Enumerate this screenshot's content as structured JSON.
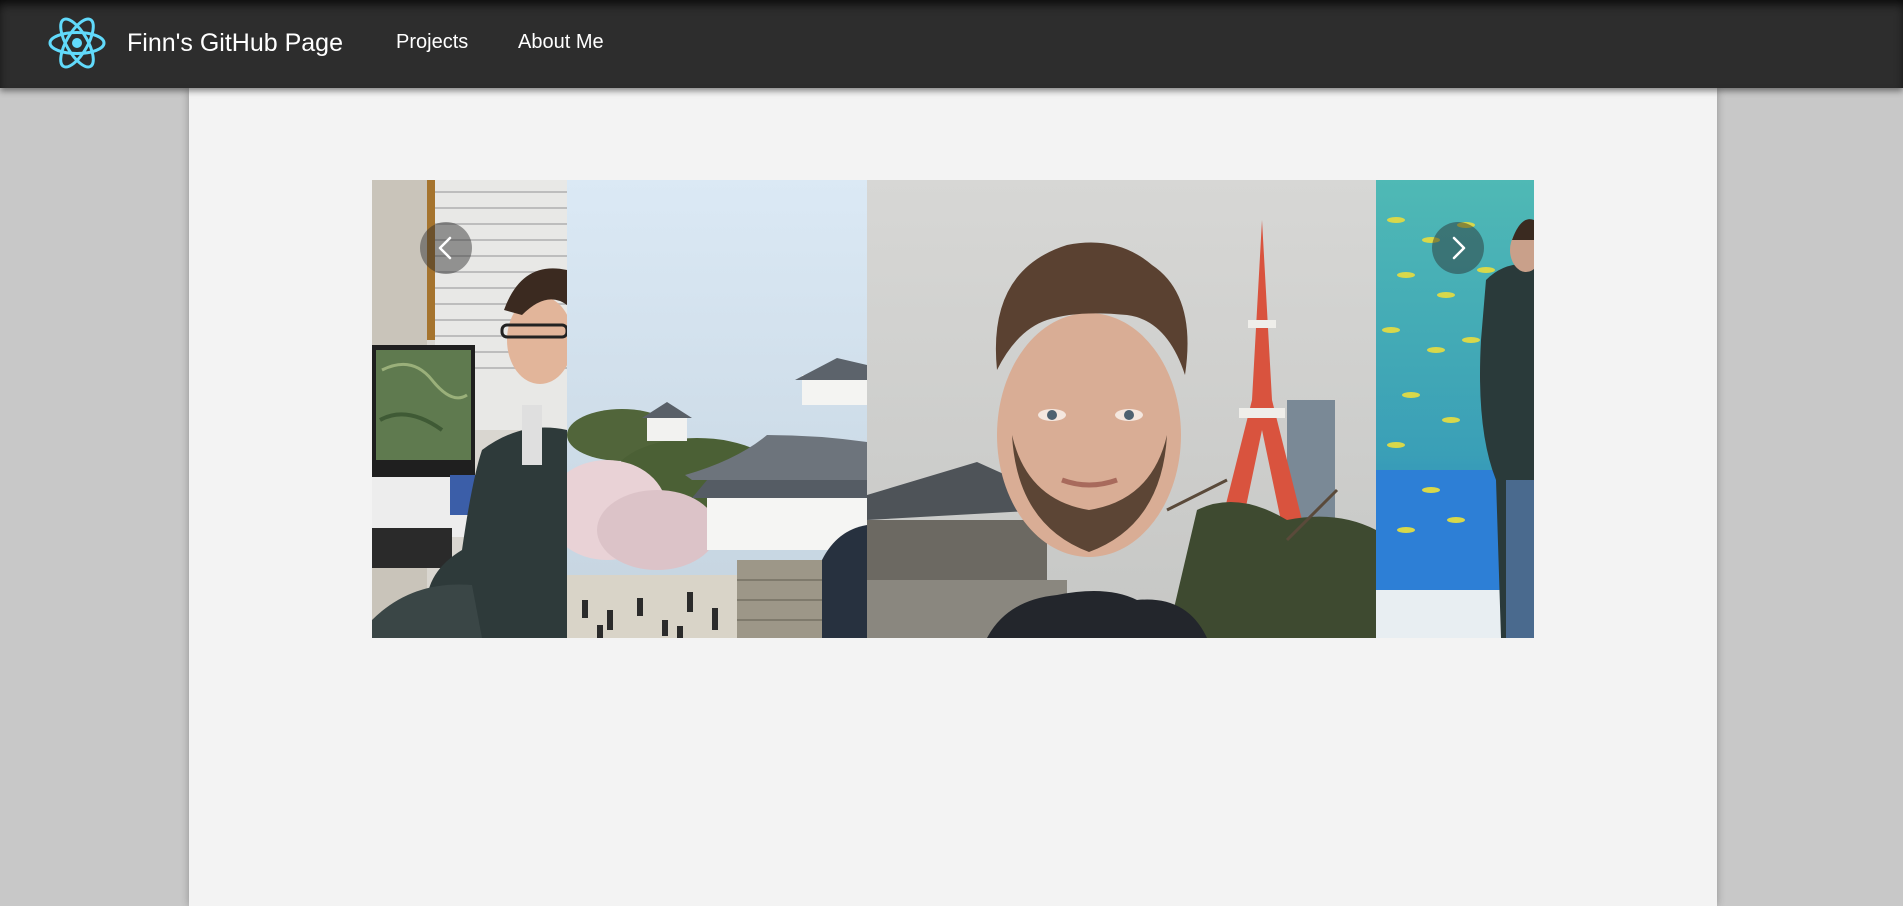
{
  "header": {
    "site_title": "Finn's GitHub Page",
    "logo_icon": "react-atom-icon",
    "nav": [
      {
        "label": "Projects"
      },
      {
        "label": "About Me"
      }
    ]
  },
  "carousel": {
    "prev_icon": "chevron-left-icon",
    "next_icon": "chevron-right-icon",
    "slide_count": 4
  },
  "colors": {
    "navbar": "#2d2d2d",
    "page_background": "#c8c8c8",
    "content_background": "#f3f3f3",
    "logo": "#61dafb",
    "nav_text": "#ffffff"
  }
}
